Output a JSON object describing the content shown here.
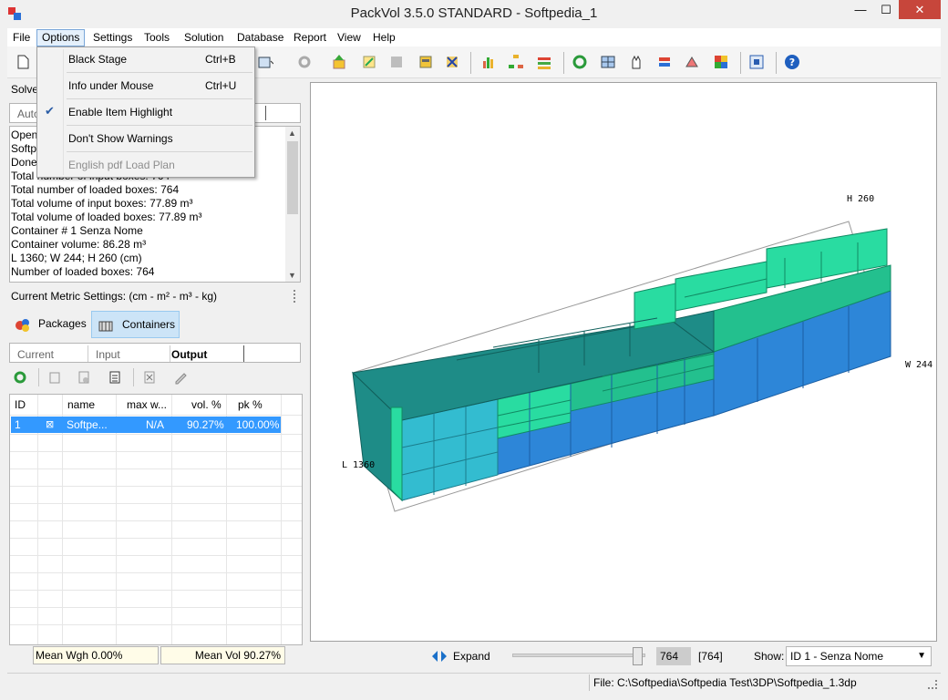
{
  "window": {
    "title": "PackVol 3.5.0 STANDARD - Softpedia_1",
    "min": "—",
    "max": "☐",
    "close": "✕"
  },
  "menubar": [
    "File",
    "Options",
    "Settings",
    "Tools",
    "Solution",
    "Database",
    "Report",
    "View",
    "Help"
  ],
  "options_menu": {
    "items": [
      {
        "label": "Black Stage",
        "shortcut": "Ctrl+B"
      },
      {
        "label": "Info under Mouse",
        "shortcut": "Ctrl+U"
      },
      {
        "label": "Enable Item Highlight",
        "shortcut": "",
        "checked": true
      },
      {
        "label": "Don't Show Warnings",
        "shortcut": ""
      },
      {
        "label": "English pdf Load Plan",
        "shortcut": "",
        "disabled": true
      }
    ]
  },
  "left_panel": {
    "solver_label": "Solve",
    "solver_value": "Auto",
    "log": [
      "Open",
      "Softp",
      "Done",
      "Total number of input boxes: 764",
      "Total number of loaded boxes:  764",
      "Total volume of input boxes: 77.89 m³",
      "Total volume of loaded boxes: 77.89 m³",
      "Container # 1 Senza Nome",
      "Container volume: 86.28 m³",
      "L 1360; W 244; H 260 (cm)",
      "Number of loaded boxes: 764"
    ],
    "metric": "Current Metric Settings: (cm - m² - m³ - kg)",
    "tabs": {
      "packages": "Packages",
      "containers": "Containers"
    },
    "subtabs": {
      "current": "Current",
      "input": "Input",
      "output": "Output"
    },
    "grid": {
      "headers": [
        "ID",
        "",
        "name",
        "max w...",
        "vol. %",
        "pk %"
      ],
      "rows": [
        {
          "id": "1",
          "icon": "⊠",
          "name": "Softpe...",
          "maxw": "N/A",
          "vol": "90.27%",
          "pk": "100.00%"
        }
      ]
    }
  },
  "view": {
    "axis_h": "H 260",
    "axis_w": "W 244",
    "axis_l": "L 1360",
    "colors": {
      "teal": "#1e8c87",
      "cyan": "#33bcd0",
      "blue": "#2d86d8",
      "green": "#29dca1"
    }
  },
  "status": {
    "mean_wgh": "Mean Wgh 0.00%",
    "mean_vol": "Mean Vol 90.27%",
    "expand": "Expand",
    "count": "764",
    "count_total": "[764]",
    "show_label": "Show:",
    "show_value": "ID 1 - Senza Nome",
    "file": "File: C:\\Softpedia\\Softpedia Test\\3DP\\Softpedia_1.3dp"
  }
}
